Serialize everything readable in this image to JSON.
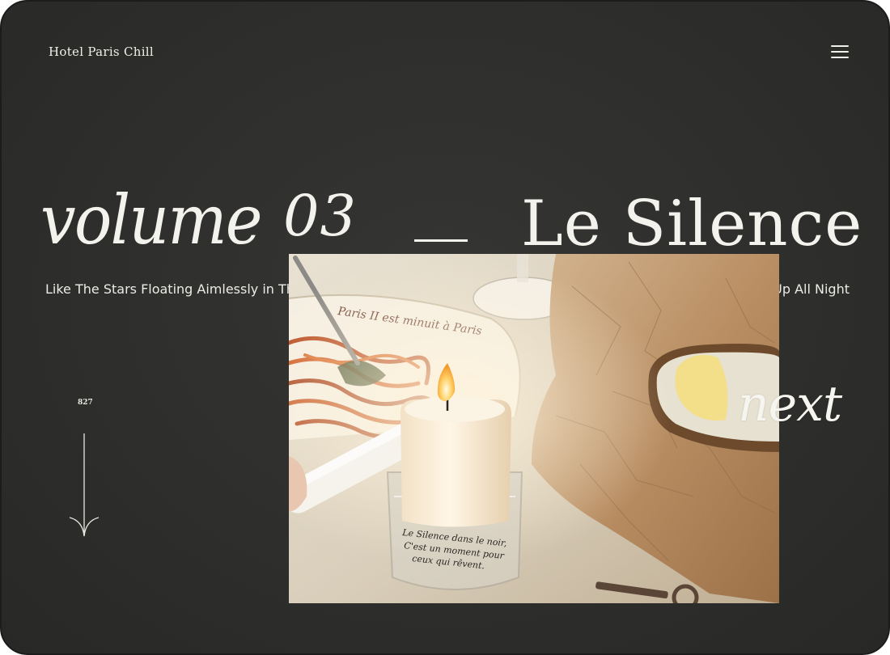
{
  "header": {
    "brand": "Hotel Paris Chill",
    "menu_icon": "hamburger-menu-icon"
  },
  "hero": {
    "volume_word": "volume",
    "volume_number": "03",
    "separator": "—",
    "title": "Le Silence",
    "subtitle_start": "Like The Stars Floating Aimlessly in The",
    "subtitle_end": "Up All Night"
  },
  "scroll": {
    "counter": "827",
    "arrow_icon": "arrow-down-icon"
  },
  "gallery": {
    "image": "candle-dinner-photo",
    "next_label": "next"
  },
  "colors": {
    "background": "#2f2f2d",
    "text": "#f1efe9"
  }
}
